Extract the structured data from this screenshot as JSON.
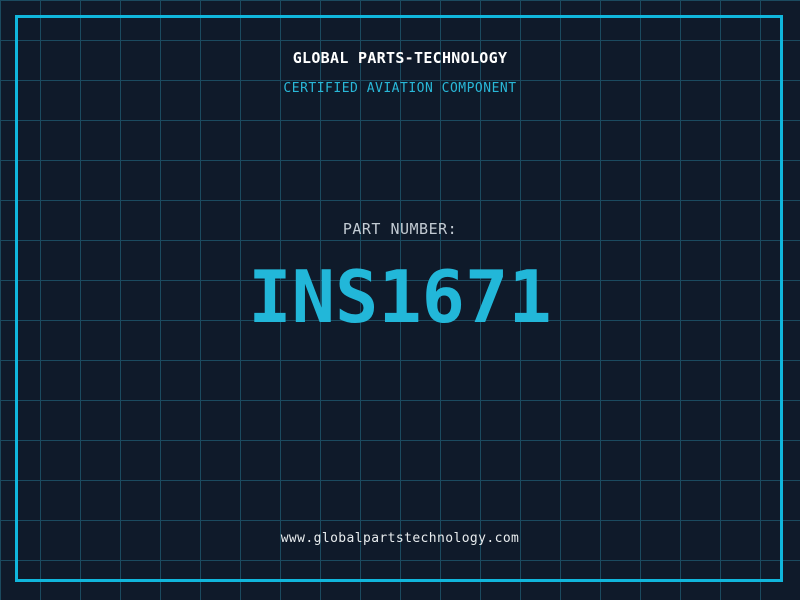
{
  "brand": {
    "title": "GLOBAL PARTS-TECHNOLOGY",
    "subtitle": "CERTIFIED AVIATION COMPONENT"
  },
  "part": {
    "label": "PART NUMBER:",
    "number": "INS1671"
  },
  "footer": {
    "website": "www.globalpartstechnology.com"
  },
  "colors": {
    "background": "#0f1a2a",
    "grid_line": "#1b4a5f",
    "frame": "#10b6dc",
    "title_text": "#ffffff",
    "subtitle_text": "#29b8d8",
    "label_text": "#c3cbd3",
    "part_number_text": "#22b7d9",
    "footer_text": "#e8ecee"
  },
  "layout_meta": {
    "grid_spacing_px": "40"
  }
}
